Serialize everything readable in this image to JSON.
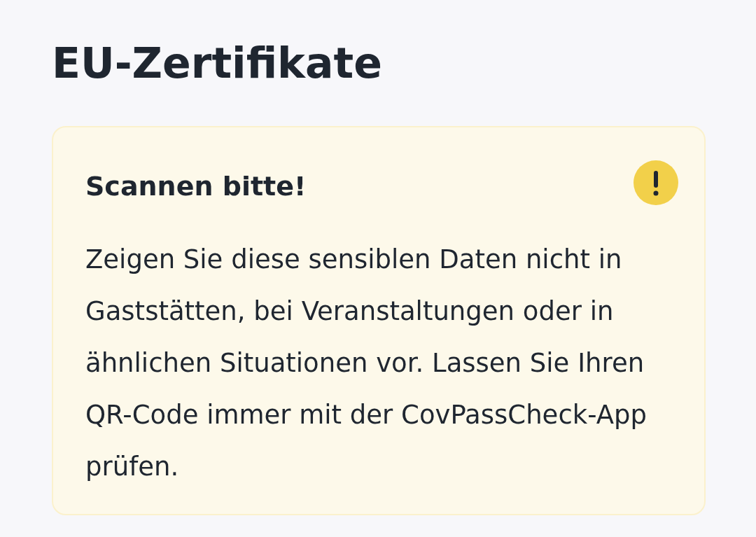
{
  "title": "EU-Zertifikate",
  "notice": {
    "kind": "warning",
    "title": "Scannen bitte!",
    "body": "Zeigen Sie diese sensiblen Daten nicht in Gaststätten, bei Veranstaltungen oder in ähnlichen Situationen vor. Lassen Sie Ihren QR-Code immer mit der CovPassCheck-App prüfen."
  }
}
